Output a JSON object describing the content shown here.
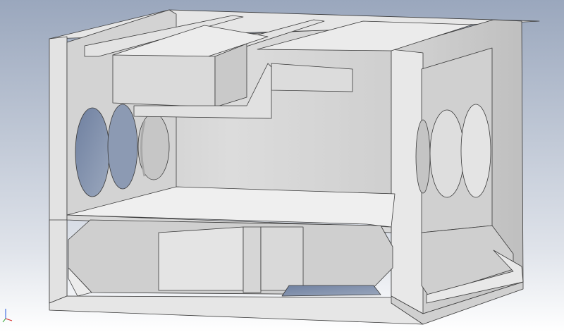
{
  "viewport": {
    "background_top": "#9aa7bd",
    "background_bottom": "#ffffff",
    "model_face_light": "#e9e9e9",
    "model_face_mid": "#d6d6d6",
    "model_face_dark": "#bdbdbd",
    "model_edge": "#3a3a3a",
    "hole_sky": "#7f8ea8",
    "hole_grey": "#c8c8c8"
  },
  "triad": {
    "x_color": "#d22222",
    "y_color": "#22a022",
    "z_color": "#2255dd",
    "x_label": "",
    "y_label": "",
    "z_label": ""
  },
  "model": {
    "name": "",
    "openings_left_side": 3,
    "openings_right_side": 3
  }
}
